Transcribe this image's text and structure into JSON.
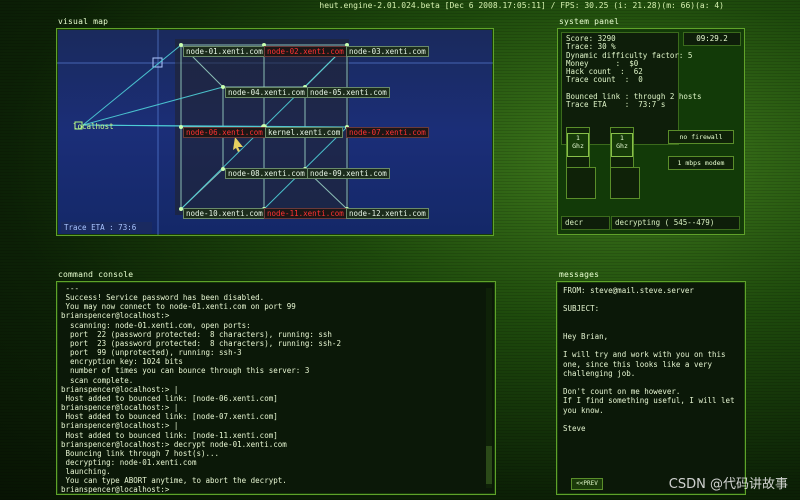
{
  "status_bar": "heut.engine-2.01.024.beta [Dec  6 2008.17:05:11] / FPS: 30.25 (i: 21.28)(m:  66)(a: 4)",
  "visual_map": {
    "title": "visual map",
    "localhost_label": "localhost",
    "trace_eta": "Trace ETA    :  73:6",
    "nodes": [
      {
        "label": "node-01.xenti.com",
        "state": "ok"
      },
      {
        "label": "node-02.xenti.com",
        "state": "bad"
      },
      {
        "label": "node-03.xenti.com",
        "state": "ok"
      },
      {
        "label": "node-04.xenti.com",
        "state": "ok"
      },
      {
        "label": "node-05.xenti.com",
        "state": "ok"
      },
      {
        "label": "node-06.xenti.com",
        "state": "bad"
      },
      {
        "label": "kernel.xenti.com",
        "state": "ok"
      },
      {
        "label": "node-07.xenti.com",
        "state": "bad"
      },
      {
        "label": "node-08.xenti.com",
        "state": "ok"
      },
      {
        "label": "node-09.xenti.com",
        "state": "ok"
      },
      {
        "label": "node-10.xenti.com",
        "state": "ok"
      },
      {
        "label": "node-11.xenti.com",
        "state": "bad"
      },
      {
        "label": "node-12.xenti.com",
        "state": "ok"
      }
    ]
  },
  "system_panel": {
    "title": "system panel",
    "clock": "09:29.2",
    "stats": "Score: 3290\nTrace: 30 %\nDynamic difficulty factor: 5\nMoney      :  $0\nHack count  :  62\nTrace count  :  0\n\nBounced link : through 2 hosts\nTrace ETA    :  73:7 s",
    "chip1": "1\nGhz",
    "chip2": "1\nGhz",
    "firewall": "no firewall",
    "modem": "1 mbps modem",
    "decr_label": "decr",
    "decr_value": "decrypting ( 545--479)"
  },
  "command_console": {
    "title": "command console",
    "text": " ---\n Success! Service password has been disabled.\n You may now connect to node-01.xenti.com on port 99\nbrianspencer@localhost:>\n  scanning: node-01.xenti.com, open ports:\n  port  22 (password protected:  8 characters), running: ssh\n  port  23 (password protected:  8 characters), running: ssh-2\n  port  99 (unprotected), running: ssh-3\n  encryption key: 1024 bits\n  number of times you can bounce through this server: 3\n  scan complete.\nbrianspencer@localhost:> |\n Host added to bounced link: [node-06.xenti.com]\nbrianspencer@localhost:> |\n Host added to bounced link: [node-07.xenti.com]\nbrianspencer@localhost:> |\n Host added to bounced link: [node-11.xenti.com]\nbrianspencer@localhost:> decrypt node-01.xenti.com\n Bouncing link through 7 host(s)...\n decrypting: node-01.xenti.com\n launching.\n You can type ABORT anytime, to abort the decrypt.\nbrianspencer@localhost:>"
  },
  "messages": {
    "title": "messages",
    "from": "FROM: steve@mail.steve.server",
    "subject": "SUBJECT:",
    "body": "Hey Brian,\n\nI will try and work with you on this\none, since this looks like a very\nchallenging job.\n\nDon't count on me however.\nIf I find something useful, I will let\nyou know.\n\nSteve",
    "prev_label": "<<PREV"
  },
  "watermark": "CSDN @代码讲故事"
}
